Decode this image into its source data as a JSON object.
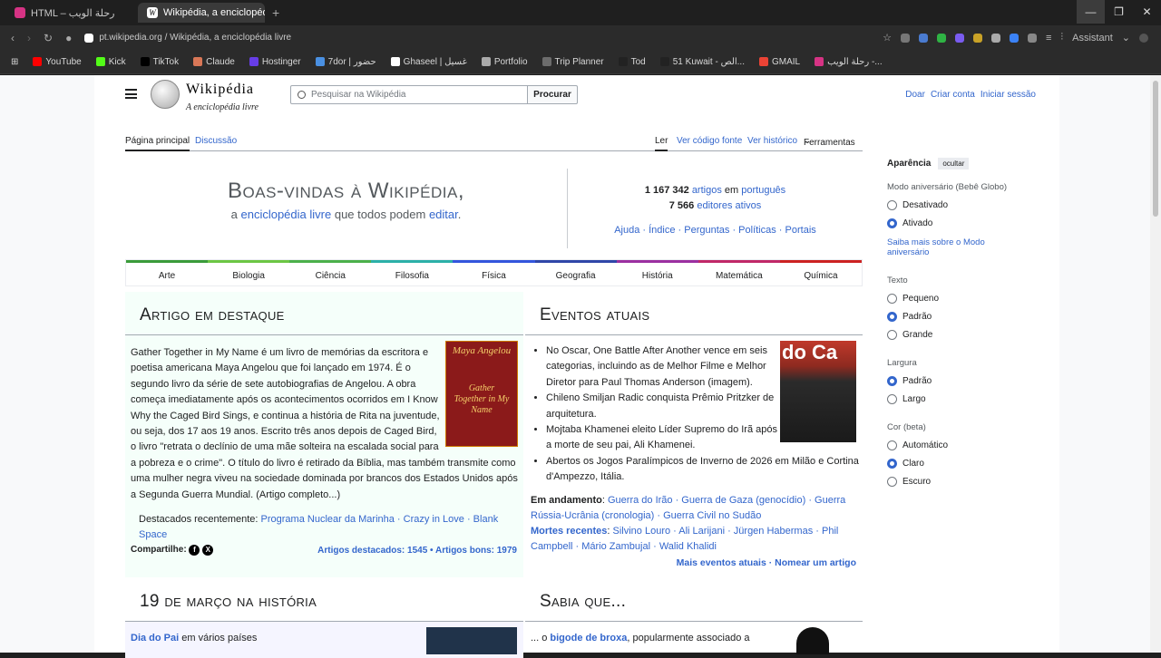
{
  "browser": {
    "tabs": [
      {
        "label": "HTML – رحلة الويب",
        "icon_color": "#d63384"
      },
      {
        "label": "Wikipédia, a enciclopédia",
        "icon_color": "#ffffff"
      }
    ],
    "url": "pt.wikipedia.org / Wikipédia, a enciclopédia livre",
    "assistant": "Assistant"
  },
  "bookmarks": [
    {
      "label": "YouTube",
      "color": "#ff0000"
    },
    {
      "label": "Kick",
      "color": "#53fc18"
    },
    {
      "label": "TikTok",
      "color": "#000000"
    },
    {
      "label": "Claude",
      "color": "#d97757"
    },
    {
      "label": "Hostinger",
      "color": "#673de6"
    },
    {
      "label": "7dor | حضور",
      "color": "#4a90e2"
    },
    {
      "label": "Ghaseel | غسيل",
      "color": "#ffffff"
    },
    {
      "label": "Portfolio",
      "color": "#aaaaaa"
    },
    {
      "label": "Trip Planner",
      "color": "#6c6c6c"
    },
    {
      "label": "Tod",
      "color": "#222222"
    },
    {
      "label": "51 Kuwait - الص...",
      "color": "#222222"
    },
    {
      "label": "GMAIL",
      "color": "#ea4335"
    },
    {
      "label": "رحلة الويب -...",
      "color": "#d63384"
    }
  ],
  "wiki": {
    "wordmark": "Wikipédia",
    "tagline": "A enciclopédia livre",
    "search_placeholder": "Pesquisar na Wikipédia",
    "search_btn": "Procurar",
    "user_links": [
      "Doar",
      "Criar conta",
      "Iniciar sessão"
    ],
    "tabs_left": [
      "Página principal",
      "Discussão"
    ],
    "tabs_right": [
      "Ler",
      "Ver código fonte",
      "Ver histórico",
      "Ferramentas"
    ],
    "welcome_title": "Boas-vindas à Wikipédia,",
    "welcome_sub": {
      "a": "a",
      "link1": "enciclopédia livre",
      "mid": "que todos podem",
      "link2": "editar",
      "end": "."
    },
    "stats": {
      "articles_num": "1 167 342",
      "articles_link": "artigos",
      "em": "em",
      "lang": "português",
      "editors_num": "7 566",
      "editors_link": "editores ativos"
    },
    "help_links": "Ajuda · Índice · Perguntas · Políticas · Portais",
    "portals": [
      {
        "label": "Arte",
        "color": "#3a9b3a"
      },
      {
        "label": "Biologia",
        "color": "#6cc644"
      },
      {
        "label": "Ciência",
        "color": "#4bb04b"
      },
      {
        "label": "Filosofia",
        "color": "#2bb0a8"
      },
      {
        "label": "Física",
        "color": "#3355dd"
      },
      {
        "label": "Geografia",
        "color": "#2f46a8"
      },
      {
        "label": "História",
        "color": "#9b2fa0"
      },
      {
        "label": "Matemática",
        "color": "#c02868"
      },
      {
        "label": "Química",
        "color": "#cc2222"
      }
    ],
    "featured": {
      "title": "Artigo em destaque",
      "text": "Gather Together in My Name é um livro de memórias da escritora e poetisa americana Maya Angelou que foi lançado em 1974. É o segundo livro da série de sete autobiografias de Angelou. A obra começa imediatamente após os acontecimentos ocorridos em I Know Why the Caged Bird Sings, e continua a história de Rita na juventude, ou seja, dos 17 aos 19 anos. Escrito três anos depois de Caged Bird, o livro \"retrata o declínio de uma mãe solteira na escalada social para a pobreza e o crime\". O título do livro é retirado da Bíblia, mas também transmite como uma mulher negra viveu na sociedade dominada por brancos dos Estados Unidos após a Segunda Guerra Mundial. (Artigo completo...)",
      "recent_label": "Destacados recentemente:",
      "recent": "Programa Nuclear da Marinha · Crazy in Love · Blank Space",
      "share": "Compartilhe:",
      "counts": "Artigos destacados: 1545 • Artigos bons: 1979",
      "book": {
        "author": "Maya Angelou",
        "title": "Gather Together in My Name"
      }
    },
    "events": {
      "title": "Eventos atuais",
      "items": [
        "No Oscar, One Battle After Another vence em seis categorias, incluindo as de Melhor Filme e Melhor Diretor para Paul Thomas Anderson (imagem).",
        "Chileno Smiljan Radic conquista Prêmio Pritzker de arquitetura.",
        "Mojtaba Khamenei eleito Líder Supremo do Irã após a morte de seu pai, Ali Khamenei.",
        "Abertos os Jogos Paralímpicos de Inverno de 2026 em Milão e Cortina d'Ampezzo, Itália."
      ],
      "ongoing_label": "Em andamento",
      "ongoing": "Guerra do Irão · Guerra de Gaza (genocídio) · Guerra Rússia-Ucrânia (cronologia) · Guerra Civil no Sudão",
      "deaths_label": "Mortes recentes",
      "deaths": "Silvino Louro · Ali Larijani · Jürgen Habermas · Phil Campbell · Mário Zambujal · Walid Khalidi",
      "more": "Mais eventos atuais · Nomear um artigo",
      "img_text": "do Ca"
    },
    "history": {
      "title": "19 de março na história",
      "first": "Dia do Pai",
      "first_rest": "em vários países"
    },
    "didyouknow": {
      "title": "Sabia que...",
      "first": "... o",
      "link": "bigode de broxa",
      "rest": ", popularmente associado a"
    }
  },
  "appearance": {
    "title": "Aparência",
    "hide": "ocultar",
    "bday_label": "Modo aniversário (Bebê Globo)",
    "bday": [
      "Desativado",
      "Ativado"
    ],
    "bday_more": "Saiba mais sobre o Modo aniversário",
    "text_label": "Texto",
    "text": [
      "Pequeno",
      "Padrão",
      "Grande"
    ],
    "width_label": "Largura",
    "width": [
      "Padrão",
      "Largo"
    ],
    "color_label": "Cor (beta)",
    "color": [
      "Automático",
      "Claro",
      "Escuro"
    ]
  }
}
